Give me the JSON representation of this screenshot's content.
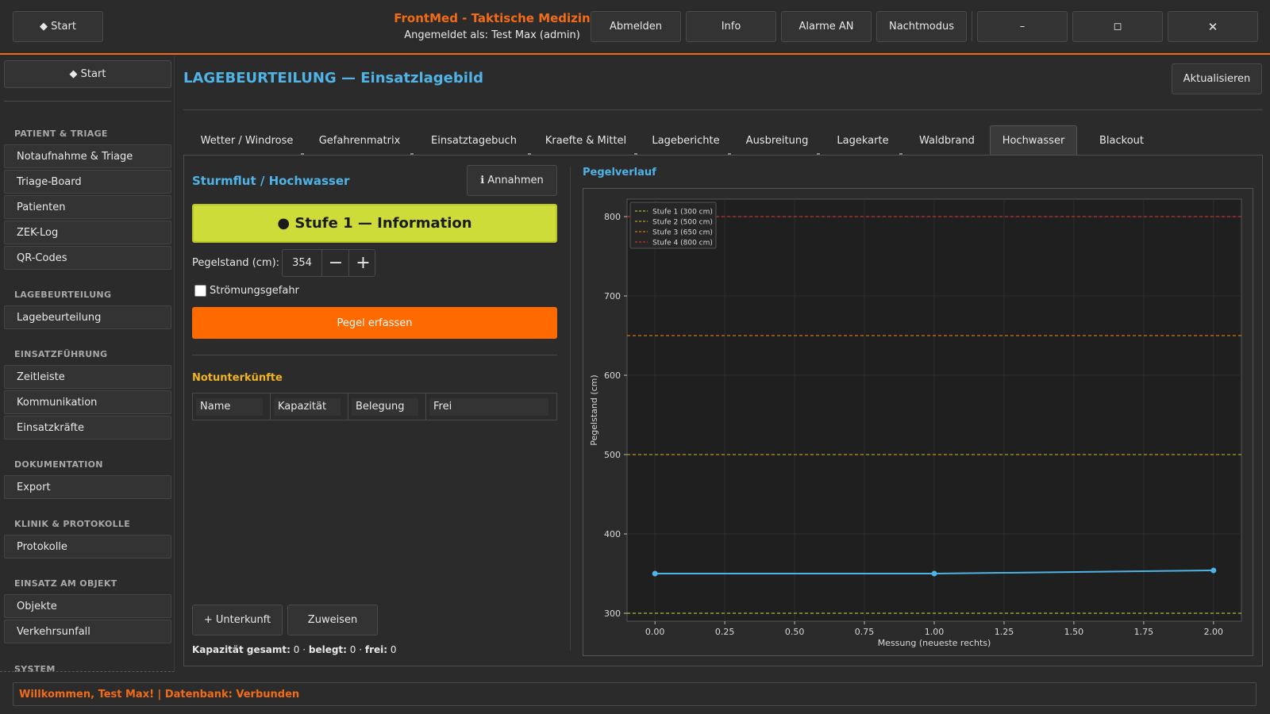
{
  "topbar": {
    "start_label": "◆  Start",
    "app_title": "FrontMed - Taktische Medizin",
    "login_info": "Angemeldet als: Test Max (admin)",
    "buttons": [
      "Abmelden",
      "Info",
      "Alarme AN",
      "Nachtmodus"
    ],
    "minimize": "–",
    "maximize": "◻",
    "close": "✕"
  },
  "sidebar": {
    "start_label": "◆  Start",
    "sections": [
      {
        "title": "PATIENT & TRIAGE",
        "items": [
          "Notaufnahme & Triage",
          "Triage-Board",
          "Patienten",
          "ZEK-Log",
          "QR-Codes"
        ]
      },
      {
        "title": "LAGEBEURTEILUNG",
        "items": [
          "Lagebeurteilung"
        ]
      },
      {
        "title": "EINSATZFÜHRUNG",
        "items": [
          "Zeitleiste",
          "Kommunikation",
          "Einsatzkräfte"
        ]
      },
      {
        "title": "DOKUMENTATION",
        "items": [
          "Export"
        ]
      },
      {
        "title": "KLINIK & PROTOKOLLE",
        "items": [
          "Protokolle"
        ]
      },
      {
        "title": "EINSATZ AM OBJEKT",
        "items": [
          "Objekte",
          "Verkehrsunfall"
        ]
      },
      {
        "title": "SYSTEM",
        "items": []
      }
    ]
  },
  "main": {
    "title": "LAGEBEURTEILUNG — Einsatzlagebild",
    "refresh_label": "Aktualisieren",
    "tabs": [
      "Wetter / Windrose",
      "Gefahrenmatrix",
      "Einsatztagebuch",
      "Kraefte & Mittel",
      "Lageberichte",
      "Ausbreitung",
      "Lagekarte",
      "Waldbrand",
      "Hochwasser",
      "Blackout"
    ],
    "active_tab": "Hochwasser"
  },
  "flood": {
    "title": "Sturmflut / Hochwasser",
    "assumptions_label": "ℹ Annahmen",
    "level_banner": "● Stufe 1 — Information",
    "level_color": "#cddc39",
    "gauge_label": "Pegelstand (cm):",
    "gauge_value": "354",
    "minus": "−",
    "plus": "+",
    "current_label": "Strömungsgefahr",
    "current_checked": false,
    "record_label": "Pegel erfassen",
    "shelters_title": "Notunterkünfte",
    "shelter_columns": [
      "Name",
      "Kapazität",
      "Belegung",
      "Frei"
    ],
    "shelter_rows": [],
    "add_shelter_label": "+ Unterkunft",
    "assign_label": "Zuweisen",
    "summary": {
      "cap_label": "Kapazität gesamt:",
      "cap": "0",
      "used_label": "belegt:",
      "used": "0",
      "free_label": "frei:",
      "free": "0"
    }
  },
  "chart_title": "Pegelverlauf",
  "chart_data": {
    "type": "line",
    "title": "",
    "xlabel": "Messung (neueste rechts)",
    "ylabel": "Pegelstand (cm)",
    "xlim": [
      -0.1,
      2.1
    ],
    "ylim": [
      290,
      822
    ],
    "xticks": [
      "0.00",
      "0.25",
      "0.50",
      "0.75",
      "1.00",
      "1.25",
      "1.50",
      "1.75",
      "2.00"
    ],
    "yticks": [
      "300",
      "400",
      "500",
      "600",
      "700",
      "800"
    ],
    "series": [
      {
        "x": [
          0,
          1,
          2
        ],
        "values": [
          350,
          350,
          354
        ],
        "color": "#4fb3e6"
      }
    ],
    "thresholds": [
      {
        "name": "Stufe 1 (300 cm)",
        "value": 300,
        "color": "#cddc39"
      },
      {
        "name": "Stufe 2 (500 cm)",
        "value": 500,
        "color": "#e0b020"
      },
      {
        "name": "Stufe 3 (650 cm)",
        "value": 650,
        "color": "#ff8a00"
      },
      {
        "name": "Stufe 4 (800 cm)",
        "value": 800,
        "color": "#e53935"
      }
    ],
    "grid": true,
    "legend": "top-left"
  },
  "status": "Willkommen, Test Max! | Datenbank: Verbunden"
}
